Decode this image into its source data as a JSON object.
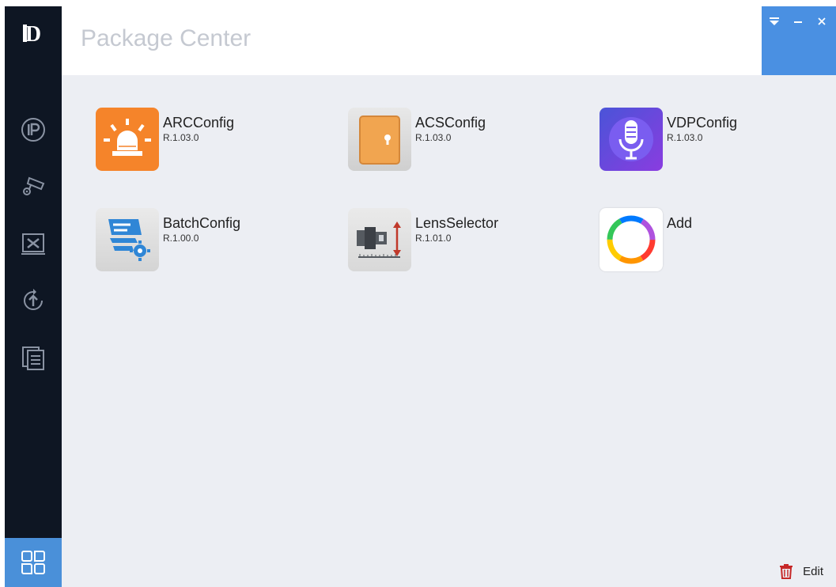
{
  "header": {
    "title": "Package Center"
  },
  "apps": [
    {
      "name": "ARCConfig",
      "version": "R.1.03.0",
      "icon": "alarm-siren-icon"
    },
    {
      "name": "ACSConfig",
      "version": "R.1.03.0",
      "icon": "door-icon"
    },
    {
      "name": "VDPConfig",
      "version": "R.1.03.0",
      "icon": "microphone-icon"
    },
    {
      "name": "BatchConfig",
      "version": "R.1.00.0",
      "icon": "batch-config-gear-icon"
    },
    {
      "name": "LensSelector",
      "version": "R.1.01.0",
      "icon": "camera-lens-icon"
    },
    {
      "name": "Add",
      "icon": "rainbow-ring-icon"
    }
  ],
  "footer": {
    "edit_label": "Edit"
  },
  "colors": {
    "sidebar": "#0e1623",
    "accent": "#4a90e2",
    "background": "#eceef3"
  }
}
